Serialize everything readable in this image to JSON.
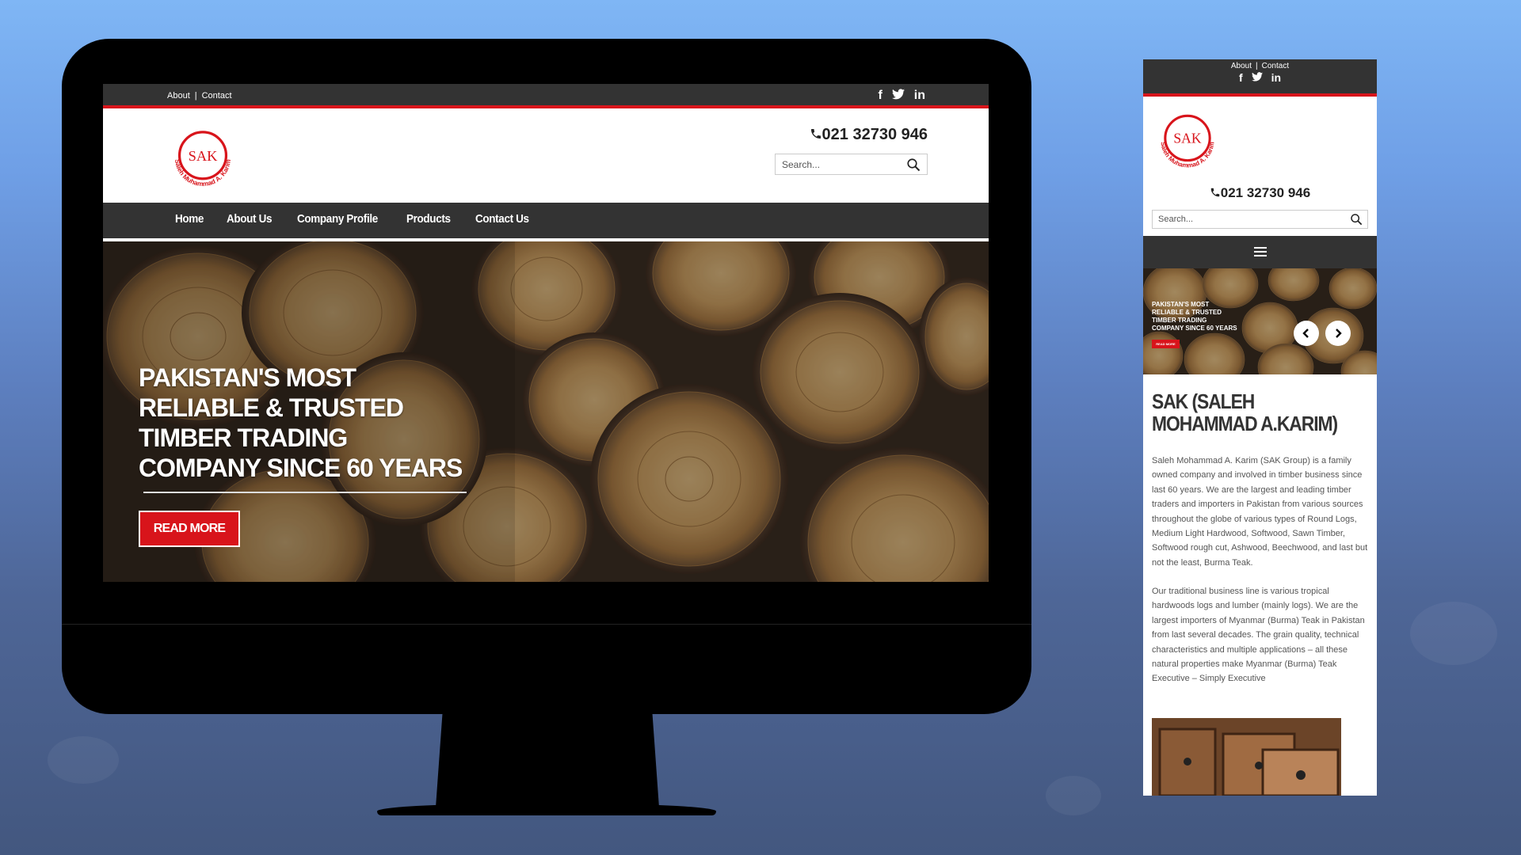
{
  "colors": {
    "accent_red": "#d8141b",
    "bar_dark": "#333333",
    "background_blue": "#6f9fe6"
  },
  "desktop": {
    "top_links": {
      "about": "About",
      "separator": "|",
      "contact": "Contact"
    },
    "social": {
      "facebook": "f",
      "twitter": "twitter-icon",
      "linkedin": "in"
    },
    "logo": {
      "main": "SAK",
      "ring_text": "Saleh Muhammad A. Karim"
    },
    "phone": "021 32730 946",
    "search": {
      "placeholder": "Search..."
    },
    "nav": [
      "Home",
      "About Us",
      "Company Profile",
      "Products",
      "Contact Us"
    ],
    "hero": {
      "title": "PAKISTAN'S MOST\nRELIABLE & TRUSTED\nTIMBER TRADING\nCOMPANY SINCE 60 YEARS",
      "button": "READ MORE"
    }
  },
  "mobile": {
    "top_links": {
      "about": "About",
      "separator": "|",
      "contact": "Contact"
    },
    "phone": "021 32730 946",
    "search": {
      "placeholder": "Search..."
    },
    "hero": {
      "title": "PAKISTAN'S MOST\nRELIABLE & TRUSTED\nTIMBER TRADING\nCOMPANY SINCE 60 YEARS",
      "button": "READ MORE"
    },
    "heading": "SAK (SALEH MOHAMMAD A.KARIM)",
    "paragraph_1": "Saleh Mohammad A. Karim (SAK Group) is a family owned company and involved in timber business since last 60 years. We are the largest and leading timber traders and importers in Pakistan from various sources throughout the globe of various types of Round Logs, Medium Light Hardwood, Softwood, Sawn Timber, Softwood rough cut, Ashwood, Beechwood, and last but not the least, Burma Teak.",
    "paragraph_2": "Our traditional business line is various tropical hardwoods logs and lumber (mainly logs). We are the largest importers of Myanmar (Burma) Teak in Pakistan from last several decades. The grain quality, technical characteristics and multiple applications – all these natural properties make Myanmar (Burma) Teak Executive – Simply Executive"
  }
}
